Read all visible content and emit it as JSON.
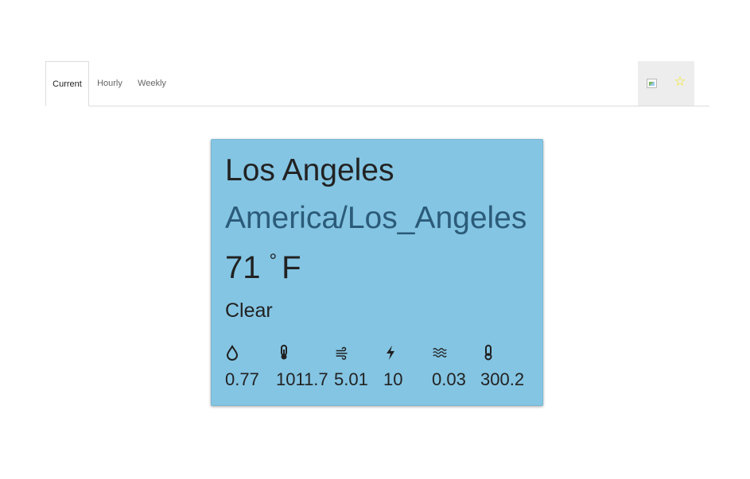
{
  "tabs": [
    {
      "label": "Current"
    },
    {
      "label": "Hourly"
    },
    {
      "label": "Weekly"
    }
  ],
  "actions": {
    "favorite_icon": "star-icon",
    "image_icon": "broken-image-icon",
    "star_color": "#f2e70d"
  },
  "card": {
    "background": "#84c5e3",
    "city": "Los Angeles",
    "timezone": "America/Los_Angeles",
    "temperature": "71",
    "degree_symbol": "°",
    "unit": "F",
    "condition": "Clear",
    "stats": [
      {
        "icon": "humidity-drop-icon",
        "value": "0.77"
      },
      {
        "icon": "pressure-thermometer-icon",
        "value": "1011.7"
      },
      {
        "icon": "wind-icon",
        "value": "5.01"
      },
      {
        "icon": "lightning-icon",
        "value": "10"
      },
      {
        "icon": "waves-icon",
        "value": "0.03"
      },
      {
        "icon": "thermometer-icon",
        "value": "300.2"
      }
    ]
  }
}
